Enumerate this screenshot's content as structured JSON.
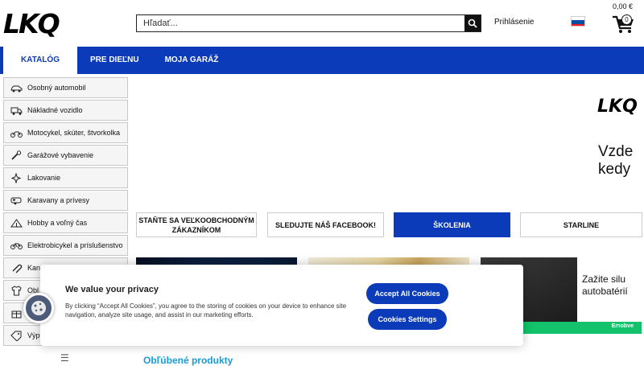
{
  "header": {
    "logo": "LKQ",
    "search_placeholder": "Hľadať...",
    "login": "Prihlásenie",
    "cart_total": "0,00 €",
    "cart_count": "0"
  },
  "nav": {
    "items": [
      "KATALÓG",
      "PRE DIEĽNU",
      "MOJA GARÁŽ"
    ]
  },
  "sidebar": {
    "items": [
      "Osobný automobil",
      "Nákladné vozidlo",
      "Motocykel, skúter, štvorkolka",
      "Garážové vybavenie",
      "Lakovanie",
      "Karavany a prívesy",
      "Hobby a voľný čas",
      "Elektrobicykel a príslušenstvo",
      "Kan",
      "Obl",
      "",
      "Výp"
    ]
  },
  "banner": {
    "logo": "LKQ",
    "line1": "Vzde",
    "line2": "kedy"
  },
  "promos": [
    "STAŇTE SA VEĽKOOBCHODNÝM ZÁKAZNÍKOM",
    "SLEDUJTE NÁŠ FACEBOOK!",
    "ŠKOLENIA",
    "STARLINE"
  ],
  "tiles": {
    "tile3_line1": "Zažite silu",
    "tile3_line2": "autobatérií",
    "tile3_brand": "Emobve"
  },
  "section_title": "Obľúbené produkty",
  "cookie": {
    "title": "We value your privacy",
    "text": "By clicking “Accept All Cookies”, you agree to the storing of cookies on your device to enhance site navigation, analyze site usage, and assist in our marketing efforts.",
    "accept": "Accept All Cookies",
    "settings": "Cookies Settings"
  },
  "colors": {
    "brand_blue": "#0b3bb8",
    "accent_green": "#13c26b",
    "link_blue": "#1a9ad6"
  }
}
